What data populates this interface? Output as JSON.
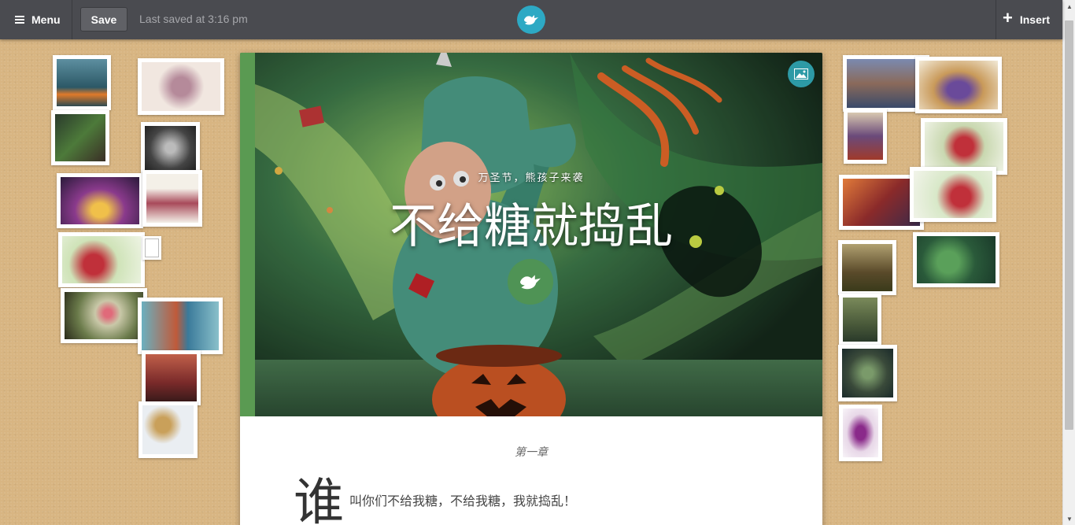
{
  "toolbar": {
    "menu_label": "Menu",
    "save_label": "Save",
    "last_saved": "Last saved at 3:16 pm",
    "insert_label": "Insert",
    "logo_icon": "bird-icon",
    "accent": "#2da9c4"
  },
  "story": {
    "subtitle": "万圣节，熊孩子来袭",
    "title": "不给糖就捣乱",
    "chapter": "第一章",
    "dropcap": "谁",
    "first_line": "叫你们不给我糖，不给我糖，我就捣乱！"
  },
  "thumbnails": {
    "left": [
      {
        "name": "pumpkin-boy"
      },
      {
        "name": "aardvark-flowers"
      },
      {
        "name": "green-monster"
      },
      {
        "name": "sketch-figure"
      },
      {
        "name": "purple-creature"
      },
      {
        "name": "hatted-lady"
      },
      {
        "name": "cardinal-bird"
      },
      {
        "name": "broken-image"
      },
      {
        "name": "girl-face-flower"
      },
      {
        "name": "red-hair-girl"
      },
      {
        "name": "red-scene"
      },
      {
        "name": "dinosaur-chase"
      }
    ],
    "right": [
      {
        "name": "cloud-rocks"
      },
      {
        "name": "anteater-balls"
      },
      {
        "name": "boy-reading"
      },
      {
        "name": "red-cardinal"
      },
      {
        "name": "red-forest-figures"
      },
      {
        "name": "santa-bird"
      },
      {
        "name": "tree-trunk"
      },
      {
        "name": "green-kid-pumpkin"
      },
      {
        "name": "forest-girl"
      },
      {
        "name": "owl-monster"
      },
      {
        "name": "purple-wizard"
      }
    ]
  }
}
